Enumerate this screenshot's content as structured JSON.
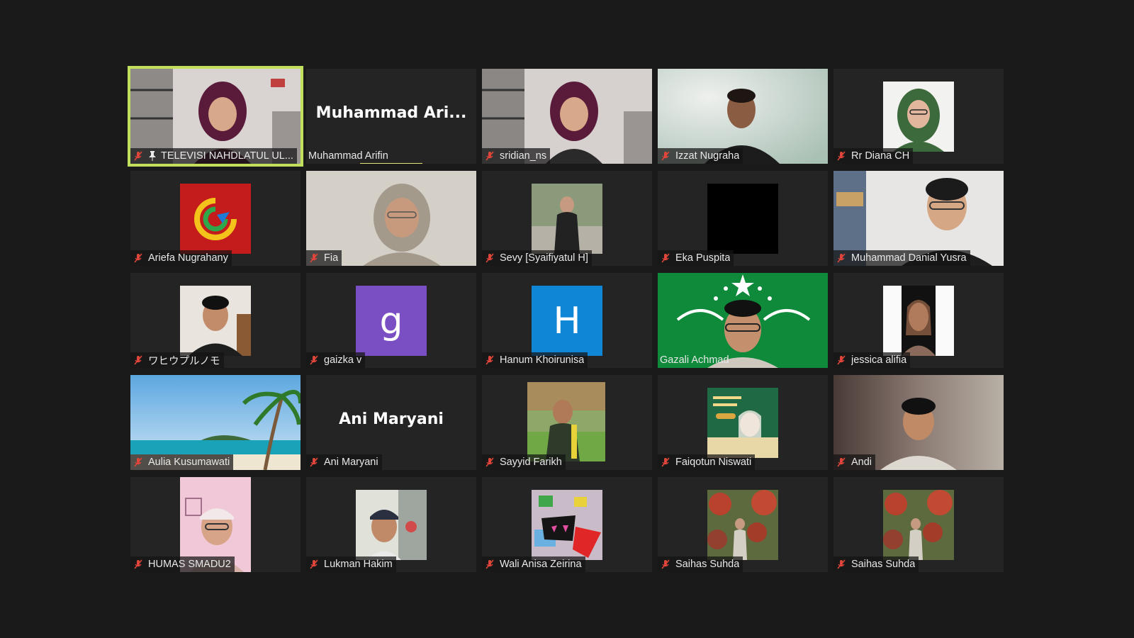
{
  "accent": {
    "active_border": "#c3e05c",
    "muted_mic": "#e0453a",
    "speaking": "#e6e67a"
  },
  "participants": [
    {
      "name": "TELEVISI NAHDLATUL UL...",
      "muted": true,
      "pinned": true,
      "active": true,
      "tile": "video",
      "icon": "person-video"
    },
    {
      "name": "Muhammad Arifin",
      "display_name": "Muhammad  Ari...",
      "muted": false,
      "tile": "name",
      "speaking": true
    },
    {
      "name": "sridian_ns",
      "muted": true,
      "tile": "video",
      "icon": "person-video"
    },
    {
      "name": "Izzat Nugraha",
      "muted": true,
      "tile": "video",
      "icon": "person-video"
    },
    {
      "name": "Rr Diana CH",
      "muted": true,
      "tile": "picture",
      "icon": "profile-photo"
    },
    {
      "name": "Ariefa Nugrahany",
      "muted": true,
      "tile": "picture",
      "icon": "logo-picture"
    },
    {
      "name": "Fia",
      "muted": true,
      "tile": "video",
      "icon": "person-video"
    },
    {
      "name": "Sevy [Syaifiyatul H]",
      "muted": true,
      "tile": "picture",
      "icon": "profile-photo"
    },
    {
      "name": "Eka Puspita",
      "muted": true,
      "tile": "picture",
      "icon": "black-picture"
    },
    {
      "name": "Muhammad Danial Yusra",
      "muted": true,
      "tile": "video",
      "icon": "person-video"
    },
    {
      "name": "ワヒウプルノモ",
      "muted": true,
      "tile": "picture",
      "icon": "profile-photo"
    },
    {
      "name": "gaizka v",
      "muted": true,
      "tile": "letter",
      "letter": "g",
      "color": "#7b4fc4"
    },
    {
      "name": "Hanum Khoirunisa",
      "muted": true,
      "tile": "letter",
      "letter": "H",
      "color": "#0f86d6"
    },
    {
      "name": "Gazali Achmad",
      "muted": false,
      "tile": "video",
      "icon": "nu-background-video"
    },
    {
      "name": "jessica alifia",
      "muted": true,
      "tile": "picture",
      "icon": "profile-photo"
    },
    {
      "name": "Aulia Kusumawati",
      "muted": true,
      "tile": "video",
      "icon": "beach-background"
    },
    {
      "name": "Ani Maryani",
      "display_name": "Ani Maryani",
      "muted": true,
      "tile": "name"
    },
    {
      "name": "Sayyid Farikh",
      "muted": true,
      "tile": "picture",
      "icon": "profile-photo"
    },
    {
      "name": "Faiqotun Niswati",
      "muted": true,
      "tile": "picture",
      "icon": "profile-photo"
    },
    {
      "name": "Andi",
      "muted": true,
      "tile": "video",
      "icon": "person-video"
    },
    {
      "name": "HUMAS SMADU2",
      "muted": true,
      "tile": "picture",
      "icon": "profile-photo"
    },
    {
      "name": "Lukman Hakim",
      "muted": true,
      "tile": "picture",
      "icon": "profile-photo"
    },
    {
      "name": "Wali Anisa Zeirina",
      "muted": true,
      "tile": "picture",
      "icon": "profile-photo"
    },
    {
      "name": "Saihas Suhda",
      "muted": true,
      "tile": "picture",
      "icon": "profile-photo"
    },
    {
      "name": "Saihas Suhda",
      "muted": true,
      "tile": "picture",
      "icon": "profile-photo"
    }
  ]
}
